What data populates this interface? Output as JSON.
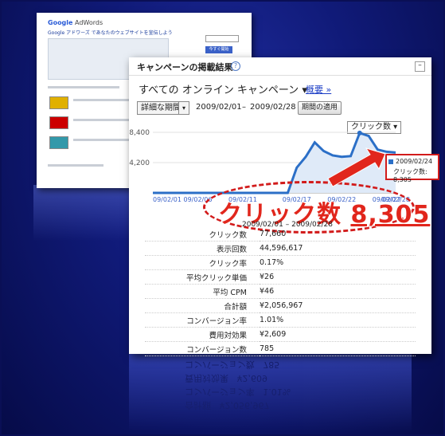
{
  "colors": {
    "accent_red": "#e1261c",
    "chart_blue": "#2b6fc7",
    "background_navy": "#101a78"
  },
  "back_page": {
    "logo_prefix": "Google",
    "logo_suffix": "AdWords",
    "headline": "Google アドワーズ であなたのウェブサイトを宣伝しよう",
    "button": "今すぐ開始"
  },
  "panel": {
    "title": "キャンペーンの掲載結果",
    "help_icon": "?",
    "min_icon": "–",
    "campaign_select": "すべての オンライン キャンペーン ▾",
    "overview_link": "概要 »",
    "period_select": "詳細な期間:",
    "period_dropdown_icon": "▾",
    "date_from": "2009/02/01",
    "date_sep": "–",
    "date_to": "2009/02/28",
    "apply_button": "期間の適用",
    "metric_select": "クリック数 ▾",
    "date_range": "2009/02/01 – 2009/02/28"
  },
  "tooltip": {
    "date": "2009/02/24",
    "value": "クリック数: 8,305"
  },
  "highlight": {
    "label": "クリック数",
    "value": "8,305"
  },
  "chart_data": {
    "type": "area",
    "x": [
      "09/02/01",
      "09/02/02",
      "09/02/03",
      "09/02/04",
      "09/02/05",
      "09/02/06",
      "09/02/07",
      "09/02/08",
      "09/02/09",
      "09/02/10",
      "09/02/11",
      "09/02/12",
      "09/02/13",
      "09/02/14",
      "09/02/15",
      "09/02/16",
      "09/02/17",
      "09/02/18",
      "09/02/19",
      "09/02/20",
      "09/02/21",
      "09/02/22",
      "09/02/23",
      "09/02/24",
      "09/02/25",
      "09/02/26",
      "09/02/27",
      "09/02/28"
    ],
    "values": [
      0,
      0,
      0,
      0,
      0,
      0,
      0,
      0,
      0,
      0,
      0,
      0,
      0,
      0,
      0,
      0,
      3500,
      5000,
      7000,
      5800,
      5200,
      5000,
      5100,
      8305,
      7900,
      6000,
      5700,
      5600
    ],
    "x_tick_labels": [
      "09/02/01",
      "09/02/06",
      "09/02/11",
      "09/02/17",
      "09/02/22",
      "09/02/27",
      "09/02/28"
    ],
    "y_tick_labels": [
      "8,400",
      "4,200"
    ],
    "ylim": [
      0,
      8400
    ],
    "series": [
      {
        "values": []
      }
    ]
  },
  "stats": [
    {
      "label": "クリック数",
      "value": "77,660"
    },
    {
      "label": "表示回数",
      "value": "44,596,617"
    },
    {
      "label": "クリック率",
      "value": "0.17%"
    },
    {
      "label": "平均クリック単価",
      "value": "¥26"
    },
    {
      "label": "平均 CPM",
      "value": "¥46"
    },
    {
      "label": "合計額",
      "value": "¥2,056,967"
    },
    {
      "label": "コンバージョン率",
      "value": "1.01%"
    },
    {
      "label": "費用対効果",
      "value": "¥2,609"
    },
    {
      "label": "コンバージョン数",
      "value": "785"
    }
  ]
}
